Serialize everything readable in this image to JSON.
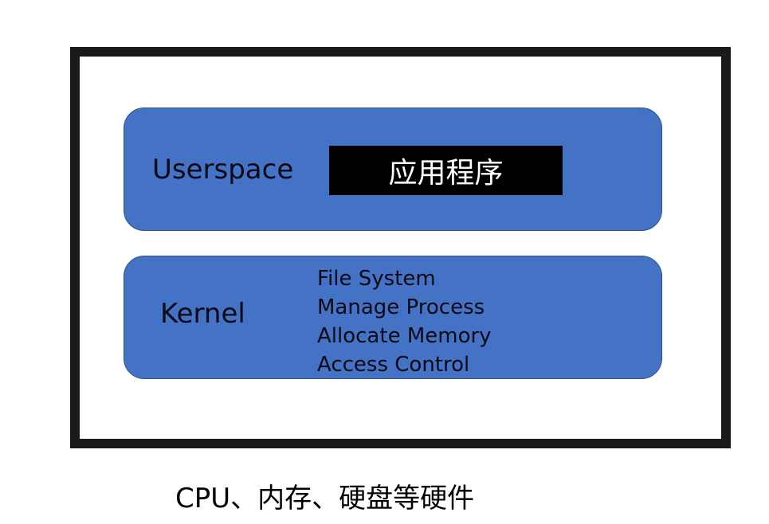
{
  "colors": {
    "layer_fill": "#4472c4",
    "layer_border": "#2f528f",
    "frame_border": "#1a1a1a",
    "app_fill": "#000000",
    "app_text": "#ffffff"
  },
  "userspace": {
    "label": "Userspace",
    "app_label": "应用程序"
  },
  "kernel": {
    "label": "Kernel",
    "items": [
      "File System",
      "Manage Process",
      "Allocate Memory",
      "Access Control"
    ]
  },
  "hardware": {
    "label": "CPU、内存、硬盘等硬件"
  }
}
